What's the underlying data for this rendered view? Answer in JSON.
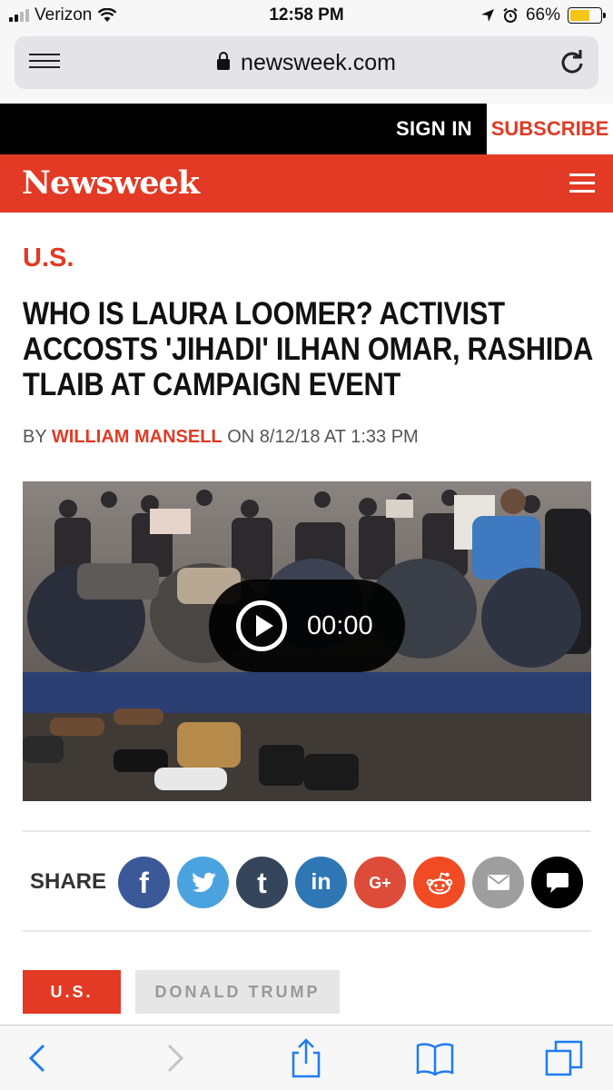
{
  "status": {
    "carrier": "Verizon",
    "time": "12:58 PM",
    "battery": "66%",
    "battery_level": 0.66
  },
  "browser": {
    "url": "newsweek.com",
    "menu_icon": "reader-menu-icon",
    "reload_icon": "reload-icon"
  },
  "site": {
    "sign_in": "SIGN IN",
    "subscribe": "SUBSCRIBE",
    "logo": "Newsweek",
    "brand_color": "#e23a24"
  },
  "article": {
    "section": "U.S.",
    "headline": "WHO IS LAURA LOOMER? ACTIVIST ACCOSTS 'JIHADI' ILHAN OMAR, RASHIDA TLAIB AT CAMPAIGN EVENT",
    "byline_prefix": "BY",
    "author": "WILLIAM MANSELL",
    "byline_date": "ON 8/12/18 AT 1:33 PM"
  },
  "video": {
    "time": "00:00"
  },
  "share": {
    "label": "SHARE",
    "buttons": [
      {
        "name": "facebook",
        "glyph": "f",
        "color": "#3b5998"
      },
      {
        "name": "twitter",
        "glyph": "t",
        "color": "#4aa3df"
      },
      {
        "name": "tumblr",
        "glyph": "t",
        "color": "#35465c"
      },
      {
        "name": "linkedin",
        "glyph": "in",
        "color": "#2e77b4"
      },
      {
        "name": "google-plus",
        "glyph": "G+",
        "color": "#dd4b39"
      },
      {
        "name": "reddit",
        "glyph": "reddit",
        "color": "#f04b23"
      },
      {
        "name": "email",
        "glyph": "mail",
        "color": "#9e9e9e"
      },
      {
        "name": "comments",
        "glyph": "comment",
        "color": "#000000"
      }
    ]
  },
  "tags": [
    "U.S.",
    "DONALD TRUMP"
  ]
}
